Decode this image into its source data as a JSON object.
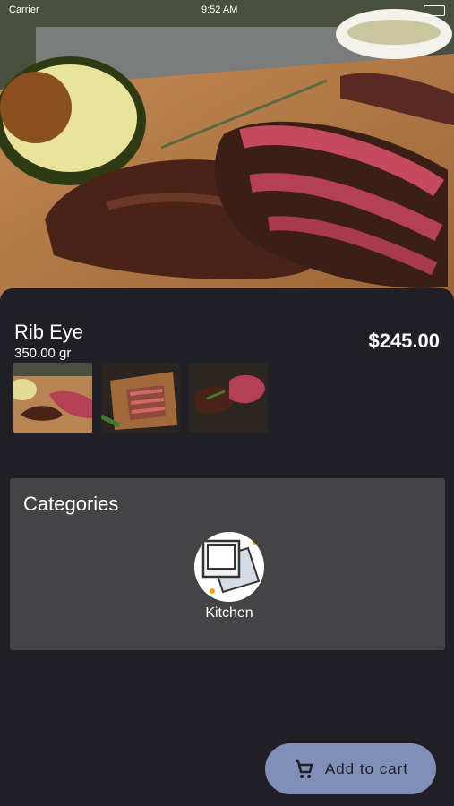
{
  "status_bar": {
    "carrier": "Carrier",
    "time": "9:52 AM"
  },
  "product": {
    "name": "Rib Eye",
    "weight": "350.00 gr",
    "price": "$245.00"
  },
  "gallery": {
    "count": 3
  },
  "categories": {
    "heading": "Categories",
    "items": [
      {
        "label": "Kitchen",
        "icon": "gallery-icon"
      }
    ]
  },
  "cart": {
    "label": "Add to cart",
    "icon": "cart-icon"
  },
  "colors": {
    "background": "#1f1f25",
    "card": "#444446",
    "button": "#7f8fb8"
  }
}
